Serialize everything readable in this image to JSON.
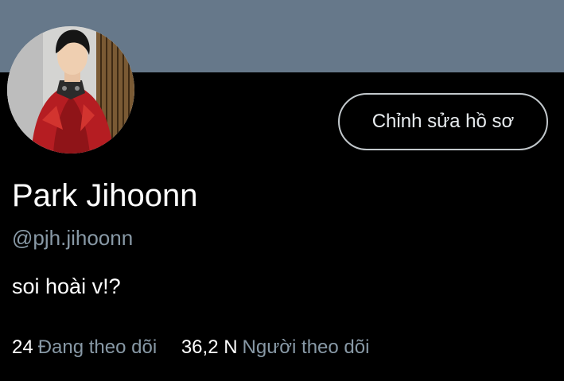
{
  "profile": {
    "display_name": "Park Jihoonn",
    "handle": "@pjh.jihoonn",
    "bio": "soi hoài v!?",
    "edit_button_label": "Chỉnh sửa hồ sơ"
  },
  "stats": {
    "following_count": "24",
    "following_label": "Đang theo dõi",
    "followers_count": "36,2 N",
    "followers_label": "Người theo dõi"
  },
  "colors": {
    "banner": "#66788a",
    "background": "#000000",
    "secondary_text": "#8899a6",
    "primary_text": "#ffffff",
    "button_border": "#c2c8cc"
  }
}
